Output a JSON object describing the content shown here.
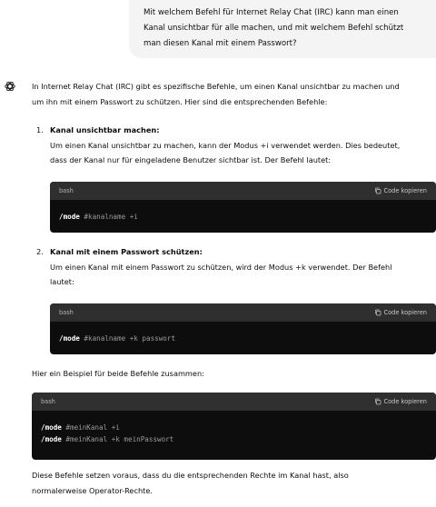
{
  "user_message": {
    "lines": [
      "Mit welchem Befehl für Internet Relay Chat (IRC) kann man einen",
      "Kanal unsichtbar für alle machen, und mit welchem Befehl schützt",
      "man diesen Kanal mit einem Passwort?"
    ]
  },
  "assistant": {
    "icon": "openai-logo-icon",
    "intro_lines": [
      "In Internet Relay Chat (IRC) gibt es spezifische Befehle, um einen Kanal unsichtbar zu machen und",
      "um ihn mit einem Passwort zu schützen. Hier sind die entsprechenden Befehle:"
    ],
    "items": [
      {
        "number": "1.",
        "title": "Kanal unsichtbar machen:",
        "lines": [
          "Um einen Kanal unsichtbar zu machen, kann der Modus +i verwendet werden. Dies bedeutet,",
          "dass der Kanal nur für eingeladene Benutzer sichtbar ist. Der Befehl lautet:"
        ],
        "code": {
          "lang": "bash",
          "copy_label": "Code kopieren",
          "cmd": "/mode",
          "args": " #kanalname +i"
        }
      },
      {
        "number": "2.",
        "title": "Kanal mit einem Passwort schützen:",
        "lines": [
          "Um einen Kanal mit einem Passwort zu schützen, wird der Modus +k verwendet. Der Befehl",
          "lautet:"
        ],
        "code": {
          "lang": "bash",
          "copy_label": "Code kopieren",
          "cmd": "/mode",
          "args": " #kanalname +k passwort"
        }
      }
    ],
    "example_intro": "Hier ein Beispiel für beide Befehle zusammen:",
    "example_code": {
      "lang": "bash",
      "copy_label": "Code kopieren",
      "lines": [
        {
          "cmd": "/mode",
          "args": " #meinKanal +i"
        },
        {
          "cmd": "/mode",
          "args": " #meinKanal +k meinPasswort"
        }
      ]
    },
    "outro_lines": [
      "Diese Befehle setzen voraus, dass du die entsprechenden Rechte im Kanal hast, also",
      "normalerweise Operator-Rechte."
    ]
  }
}
